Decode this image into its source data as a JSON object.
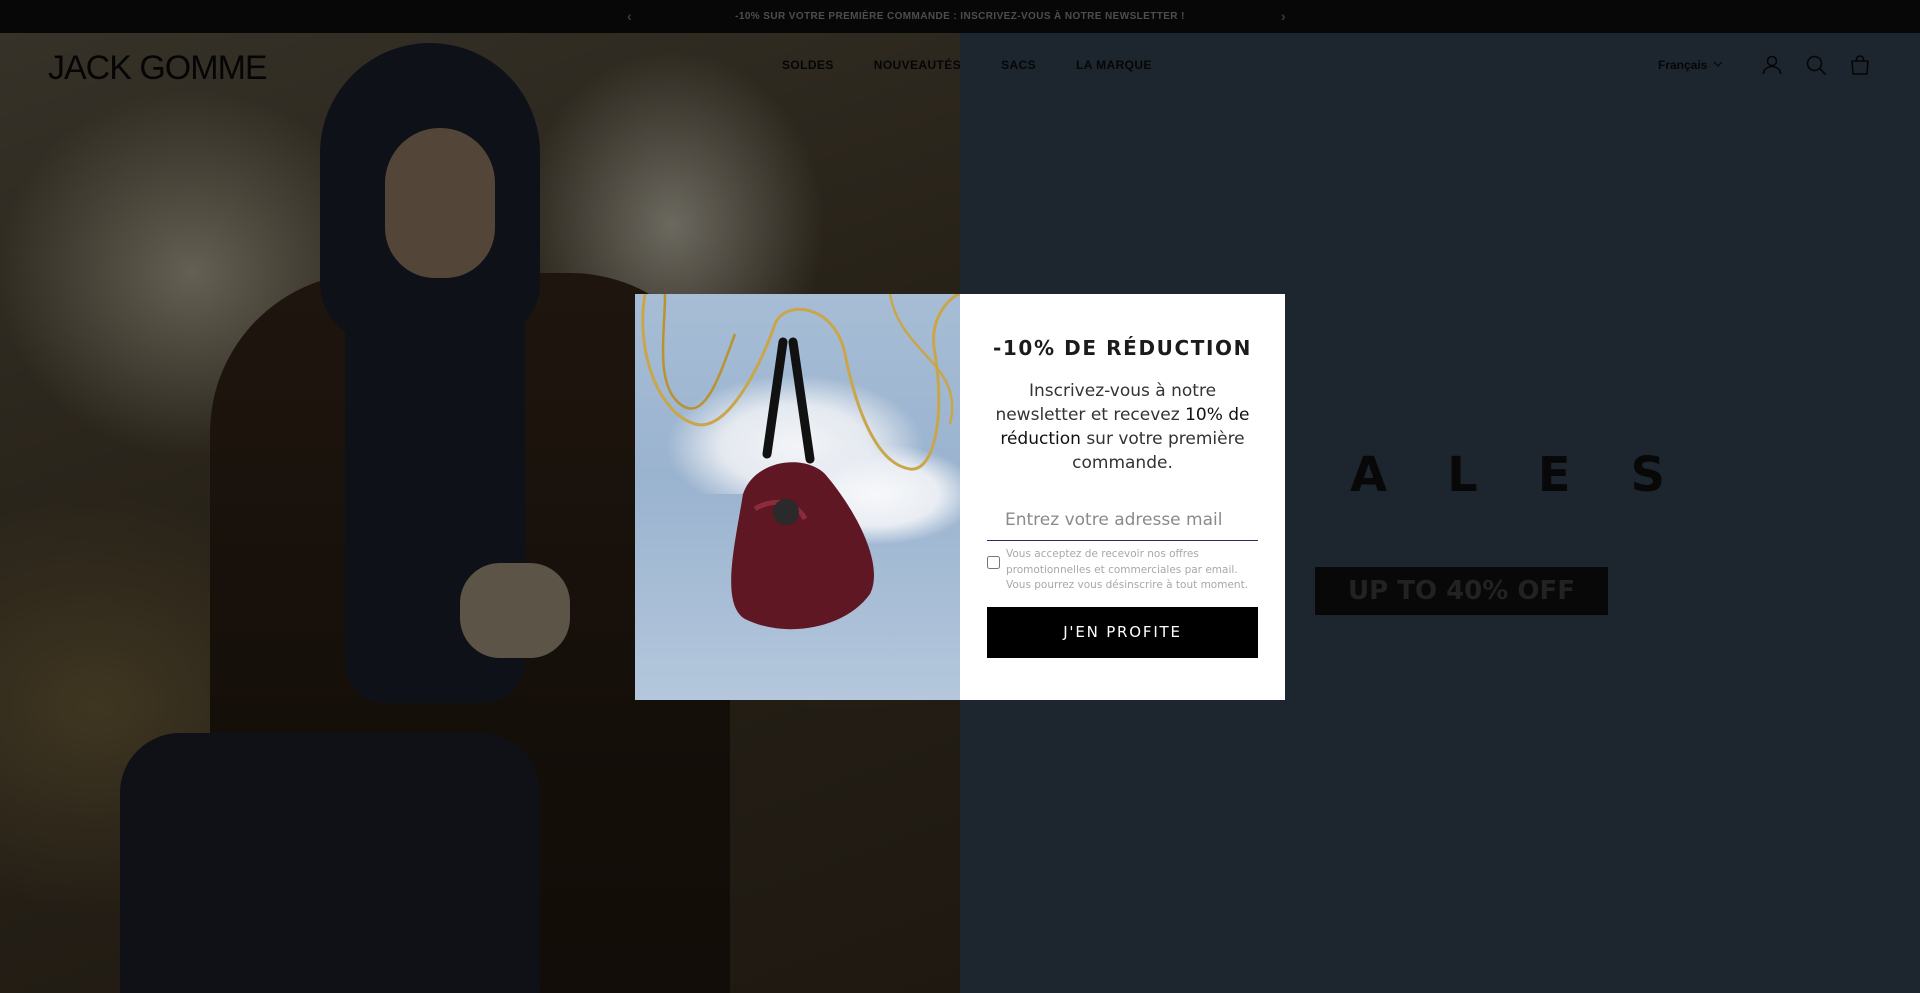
{
  "announcement": {
    "text": "-10% SUR VOTRE PREMIÈRE COMMANDE : INSCRIVEZ-VOUS À NOTRE NEWSLETTER !",
    "prev_icon": "chevron-left-icon",
    "next_icon": "chevron-right-icon"
  },
  "header": {
    "logo": "JACK GOMME",
    "nav": [
      "SOLDES",
      "NOUVEAUTÉS",
      "SACS",
      "LA MARQUE"
    ],
    "language": "Français",
    "icons": [
      "account-icon",
      "search-icon",
      "cart-icon"
    ]
  },
  "hero": {
    "sales_word": "ALES",
    "sales_badge": "UP TO 40% OFF"
  },
  "modal": {
    "title": "-10% DE RÉDUCTION",
    "desc_before": "Inscrivez-vous à notre newsletter et recevez ",
    "desc_bold": "10% de réduction",
    "desc_after": " sur votre première commande.",
    "email_placeholder": "Entrez votre adresse mail",
    "consent": "Vous acceptez de recevoir nos offres promotionnelles et commerciales par email. Vous pourrez vous désinscrire à tout moment.",
    "cta": "J'EN PROFITE"
  },
  "colors": {
    "overlay": "rgba(0,0,0,0.5)",
    "modal_bg": "#ffffff",
    "cta_bg": "#000000",
    "input_underline": "#2d2a6c",
    "right_panel": "#3b4c5f"
  }
}
